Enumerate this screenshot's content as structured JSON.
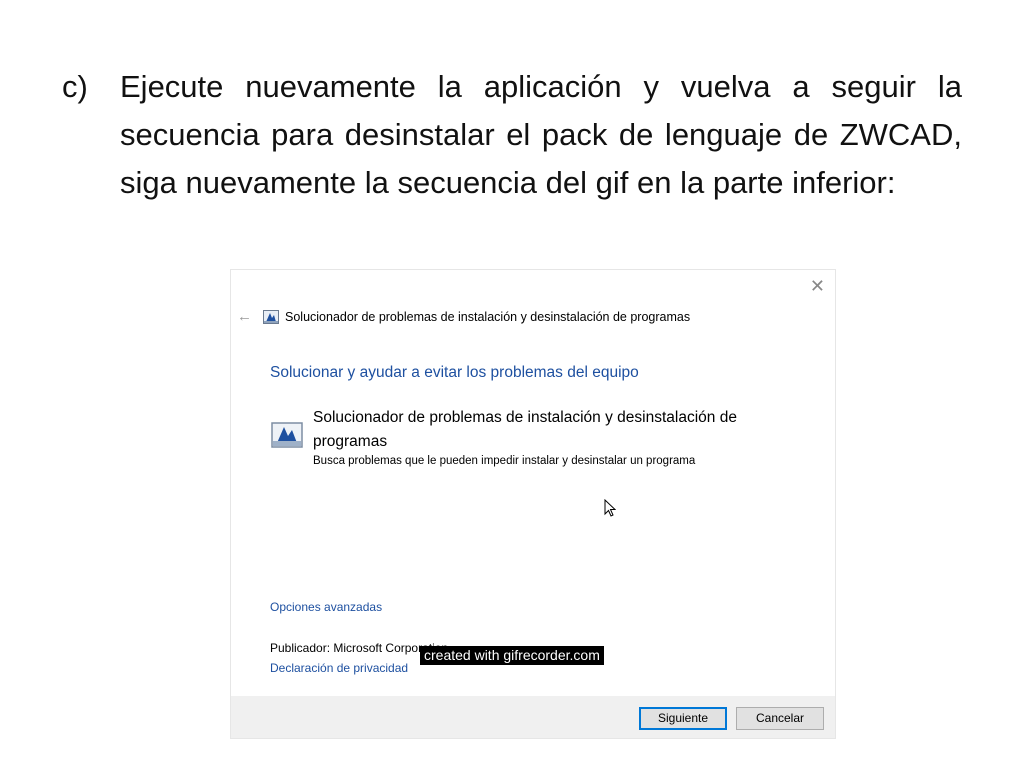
{
  "slide": {
    "bullet_marker": "c)",
    "bullet_text": "Ejecute nuevamente la aplicación y vuelva a seguir la secuencia para desinstalar el pack de lenguaje de ZWCAD, siga nuevamente la secuencia del gif en la parte inferior:"
  },
  "dialog": {
    "close_glyph": "✕",
    "back_glyph": "←",
    "window_title": "Solucionador de problemas de instalación y desinstalación de programas",
    "header": "Solucionar y ayudar a evitar los problemas del equipo",
    "option": {
      "title": "Solucionador de problemas de instalación y desinstalación de programas",
      "description": "Busca problemas que le pueden impedir instalar y desinstalar un programa",
      "icon": "troubleshooter-icon"
    },
    "advanced_link": "Opciones avanzadas",
    "publisher_label": "Publicador:",
    "publisher_value": "Microsoft Corporation",
    "privacy_link": "Declaración de privacidad",
    "watermark": "created with gifrecorder.com",
    "buttons": {
      "next": "Siguiente",
      "cancel": "Cancelar"
    }
  },
  "colors": {
    "link": "#1e50a0",
    "primary_border": "#0078d7",
    "footer_bg": "#f0f0f0"
  }
}
